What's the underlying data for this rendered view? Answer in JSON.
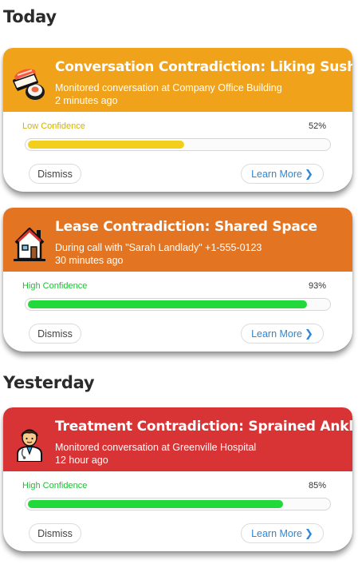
{
  "sections": [
    {
      "title": "Today"
    },
    {
      "title": "Yesterday"
    }
  ],
  "alerts": [
    {
      "title": "Conversation Contradiction: Liking Sushi",
      "subtitle": "Monitored conversation at Company Office Building",
      "time": "2 minutes ago",
      "confidence_label": "Low Confidence",
      "confidence_pct": "52%",
      "confidence_value": 0.52,
      "header_color": "#f0a21b",
      "confidence_color": "#f2cf1d",
      "icon": "sushi-icon",
      "dismiss_label": "Dismiss",
      "learn_more_label": "Learn More"
    },
    {
      "title": "Lease Contradiction: Shared Space",
      "subtitle": "During call with \"Sarah Landlady\" +1-555-0123",
      "time": "30 minutes ago",
      "confidence_label": "High Confidence",
      "confidence_pct": "93%",
      "confidence_value": 0.93,
      "header_color": "#e27422",
      "confidence_color": "#22d93b",
      "icon": "house-icon",
      "dismiss_label": "Dismiss",
      "learn_more_label": "Learn More"
    },
    {
      "title": "Treatment Contradiction: Sprained Ankle",
      "subtitle": "Monitored conversation at Greenville Hospital",
      "time": "12 hour ago",
      "confidence_label": "High Confidence",
      "confidence_pct": "85%",
      "confidence_value": 0.85,
      "header_color": "#d83436",
      "confidence_color": "#22d93b",
      "icon": "doctor-icon",
      "dismiss_label": "Dismiss",
      "learn_more_label": "Learn More"
    }
  ]
}
